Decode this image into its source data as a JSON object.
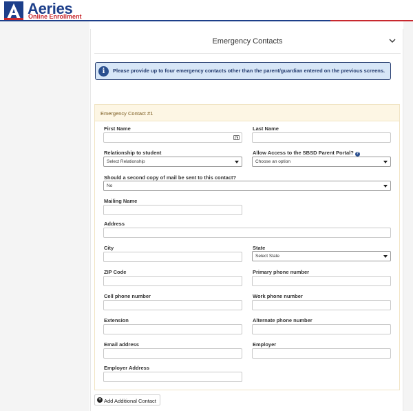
{
  "brand": {
    "name": "Aeries",
    "subtitle": "Online Enrollment",
    "logo_letter": "A"
  },
  "card": {
    "title": "Emergency Contacts"
  },
  "info": {
    "text": "Please provide up to four emergency contacts other than the parent/guardian entered on the previous screens."
  },
  "section": {
    "title": "Emergency Contact #1"
  },
  "fields": {
    "first_name": {
      "label": "First Name",
      "value": ""
    },
    "last_name": {
      "label": "Last Name",
      "value": ""
    },
    "relationship": {
      "label": "Relationship to student",
      "value": "Select Relationship"
    },
    "portal_access": {
      "label": "Allow Access to the SBSD Parent Portal?",
      "value": "Choose an option"
    },
    "second_mail": {
      "label": "Should a second copy of mail be sent to this contact?",
      "value": "No"
    },
    "mailing_name": {
      "label": "Mailing Name",
      "value": ""
    },
    "address": {
      "label": "Address",
      "value": ""
    },
    "city": {
      "label": "City",
      "value": ""
    },
    "state": {
      "label": "State",
      "value": "Select State"
    },
    "zip": {
      "label": "ZIP Code",
      "value": ""
    },
    "primary_phone": {
      "label": "Primary phone number",
      "value": ""
    },
    "cell_phone": {
      "label": "Cell phone number",
      "value": ""
    },
    "work_phone": {
      "label": "Work phone number",
      "value": ""
    },
    "extension": {
      "label": "Extension",
      "value": ""
    },
    "alternate_phone": {
      "label": "Alternate phone number",
      "value": ""
    },
    "email": {
      "label": "Email address",
      "value": ""
    },
    "employer": {
      "label": "Employer",
      "value": ""
    },
    "employer_address": {
      "label": "Employer Address",
      "value": ""
    }
  },
  "buttons": {
    "add_contact": "Add Additional Contact"
  },
  "colors": {
    "brand_blue": "#1d3f8a",
    "brand_red": "#c8282e",
    "info_bg": "#d7e6f7",
    "section_head_bg": "#fdf6e4"
  },
  "icons": [
    "aeries-logo",
    "chevron-down-icon",
    "info-icon",
    "contact-card-icon",
    "help-icon",
    "plus-circle-icon"
  ]
}
